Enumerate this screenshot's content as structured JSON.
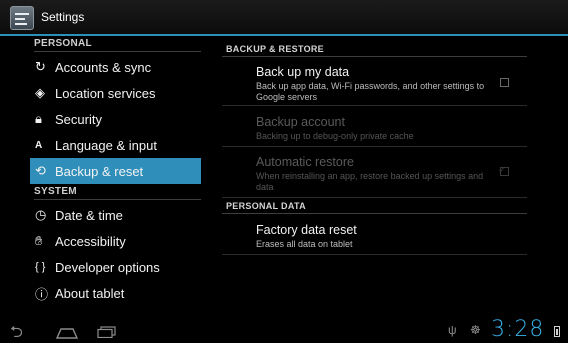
{
  "app": {
    "title": "Settings",
    "icon": "settings-icon"
  },
  "sidebar": {
    "sections": [
      {
        "label": "PERSONAL"
      },
      {
        "label": "SYSTEM"
      }
    ],
    "items": [
      {
        "label": "Accounts & sync",
        "icon": "sync-icon",
        "glyph": "↻"
      },
      {
        "label": "Location services",
        "icon": "location-icon",
        "glyph": "◈"
      },
      {
        "label": "Security",
        "icon": "lock-icon",
        "glyph": "🔒︎"
      },
      {
        "label": "Language & input",
        "icon": "keyboard-icon",
        "glyph": "A"
      },
      {
        "label": "Backup & reset",
        "icon": "restore-icon",
        "glyph": "⟲",
        "selected": true
      },
      {
        "label": "Date & time",
        "icon": "clock-icon",
        "glyph": "◷"
      },
      {
        "label": "Accessibility",
        "icon": "hand-icon",
        "glyph": "✋︎"
      },
      {
        "label": "Developer options",
        "icon": "braces-icon",
        "glyph": "{ }"
      },
      {
        "label": "About tablet",
        "icon": "info-icon",
        "glyph": "ⓘ"
      }
    ]
  },
  "content": {
    "categories": [
      {
        "label": "BACKUP & RESTORE"
      },
      {
        "label": "PERSONAL DATA"
      }
    ],
    "prefs": [
      {
        "title": "Back up my data",
        "summary": "Back up app data, Wi-Fi passwords, and other settings to Google servers",
        "checked": false,
        "enabled": true
      },
      {
        "title": "Backup account",
        "summary": "Backing up to debug-only private cache",
        "enabled": false
      },
      {
        "title": "Automatic restore",
        "summary": "When reinstalling an app, restore backed up settings and data",
        "checked": true,
        "enabled": false
      },
      {
        "title": "Factory data reset",
        "summary": "Erases all data on tablet",
        "enabled": true
      }
    ]
  },
  "statusbar": {
    "time": "3:28",
    "accent": "#36b3e8"
  },
  "colors": {
    "accent": "#2f8fba",
    "divider": "#2e90b8"
  }
}
